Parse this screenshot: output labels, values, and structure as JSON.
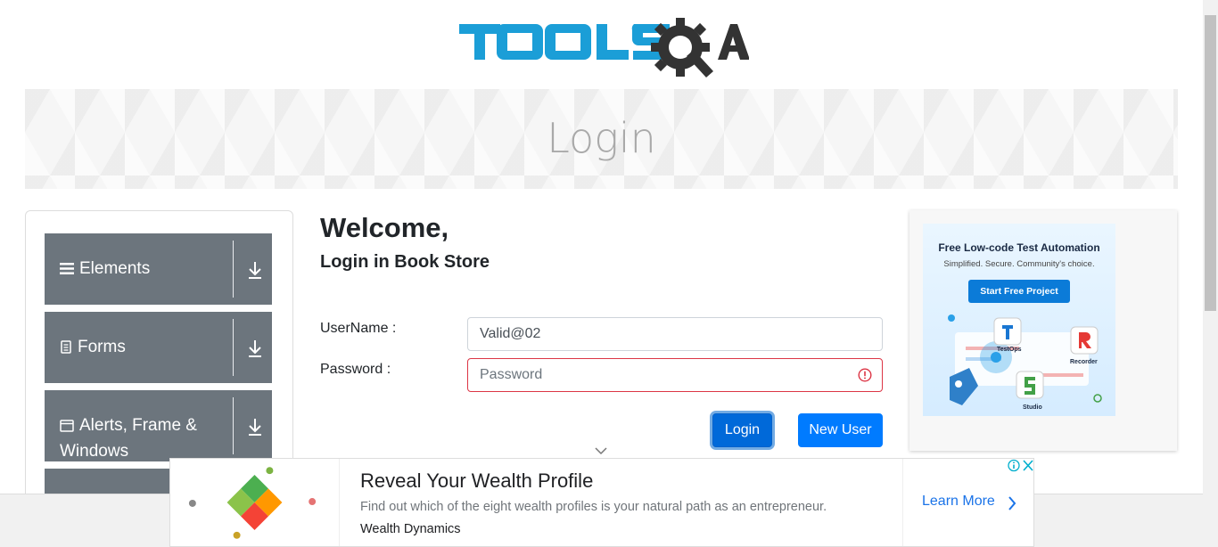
{
  "header": {
    "logo_text": "TOOLSQA"
  },
  "banner": {
    "title": "Login"
  },
  "sidebar": {
    "groups": [
      {
        "label": "Elements",
        "icon": "list-icon"
      },
      {
        "label": "Forms",
        "icon": "document-icon"
      },
      {
        "label": "Alerts, Frame &",
        "label2": "Windows",
        "icon": "window-icon"
      }
    ]
  },
  "form": {
    "welcome": "Welcome,",
    "subtitle": "Login in Book Store",
    "username_label": "UserName :",
    "username_value": "Valid@02",
    "password_label": "Password :",
    "password_placeholder": "Password",
    "login_label": "Login",
    "new_user_label": "New User"
  },
  "ad_right": {
    "headline": "Free Low-code Test Automation",
    "tagline": "Simplified. Secure. Community's choice.",
    "button": "Start Free Project",
    "products": [
      "TestOps",
      "Recorder",
      "Studio"
    ]
  },
  "ad_bottom": {
    "title": "Reveal Your Wealth Profile",
    "description": "Find out which of the eight wealth profiles is your natural path as an entrepreneur.",
    "brand": "Wealth Dynamics",
    "cta": "Learn More"
  },
  "colors": {
    "primary": "#007bff",
    "sidebar": "#6c757d",
    "error": "#dc3545",
    "logo_blue": "#1b9ed7",
    "logo_dark": "#333333"
  }
}
